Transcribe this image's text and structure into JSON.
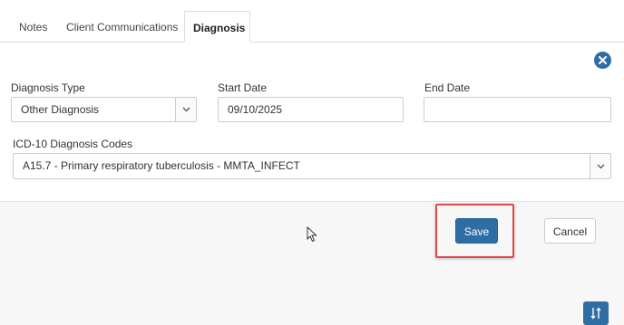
{
  "tabs": [
    {
      "label": "Notes"
    },
    {
      "label": "Client Communications"
    },
    {
      "label": "Diagnosis",
      "active": true
    }
  ],
  "form": {
    "diagnosis_type": {
      "label": "Diagnosis Type",
      "value": "Other Diagnosis"
    },
    "start_date": {
      "label": "Start Date",
      "value": "09/10/2025"
    },
    "end_date": {
      "label": "End Date",
      "value": ""
    },
    "icd10": {
      "label": "ICD-10 Diagnosis Codes",
      "value": "A15.7 - Primary respiratory tuberculosis - MMTA_INFECT"
    }
  },
  "buttons": {
    "save": "Save",
    "cancel": "Cancel"
  },
  "icons": {
    "close": "close-circle-icon",
    "dropdown": "chevron-down-icon",
    "sort": "sort-icon"
  },
  "colors": {
    "primary": "#2f6ea5",
    "highlight": "#e04a4a"
  }
}
